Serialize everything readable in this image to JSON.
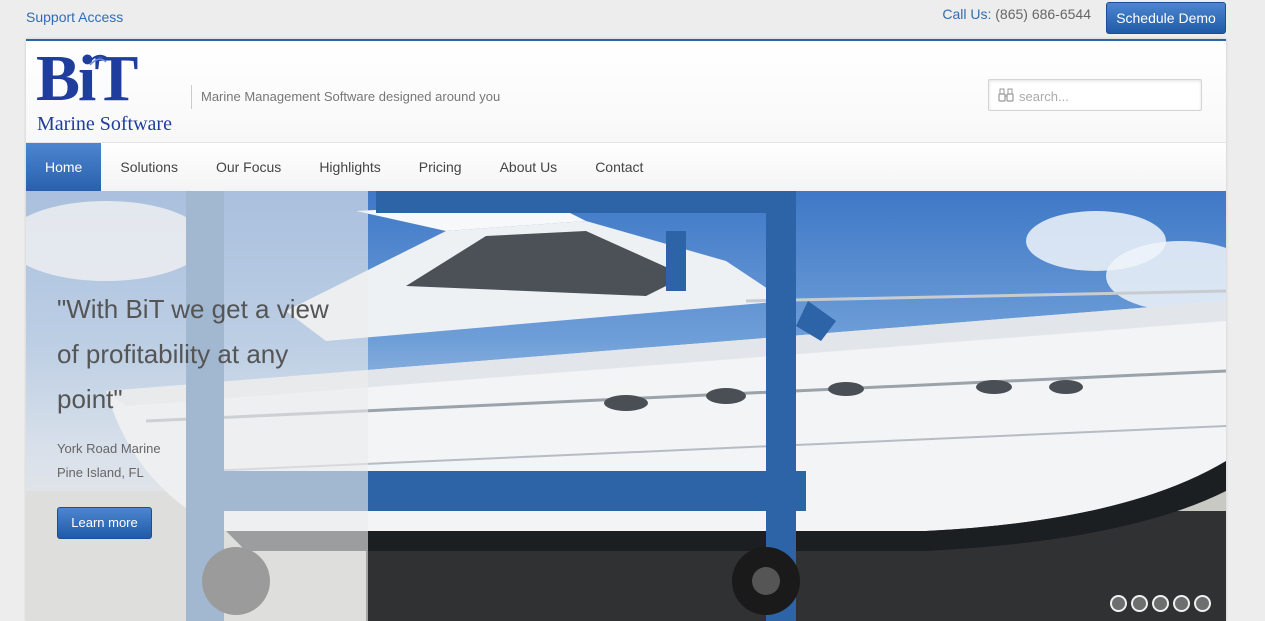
{
  "topbar": {
    "support_label": "Support Access",
    "call_label": "Call Us:",
    "phone": "(865) 686-6544",
    "demo_button": "Schedule Demo"
  },
  "header": {
    "logo_letters": "BiT",
    "logo_subtitle": "Marine Software",
    "tagline": "Marine Management Software designed around you",
    "search_placeholder": "search..."
  },
  "nav": {
    "items": [
      {
        "label": "Home",
        "active": true
      },
      {
        "label": "Solutions"
      },
      {
        "label": "Our Focus"
      },
      {
        "label": "Highlights"
      },
      {
        "label": "Pricing"
      },
      {
        "label": "About Us"
      },
      {
        "label": "Contact"
      }
    ]
  },
  "hero": {
    "quote": "\"With BiT we get a view of profitability at any point\"",
    "author_name": "York Road Marine",
    "author_location": "Pine Island, FL",
    "button": "Learn more",
    "slide_count": 5,
    "active_slide": 1
  },
  "colors": {
    "accent": "#2960ac",
    "logo": "#1f3d9c",
    "link": "#2f6db5"
  },
  "icons": [
    "binoculars-icon",
    "logo-swoosh-icon"
  ]
}
